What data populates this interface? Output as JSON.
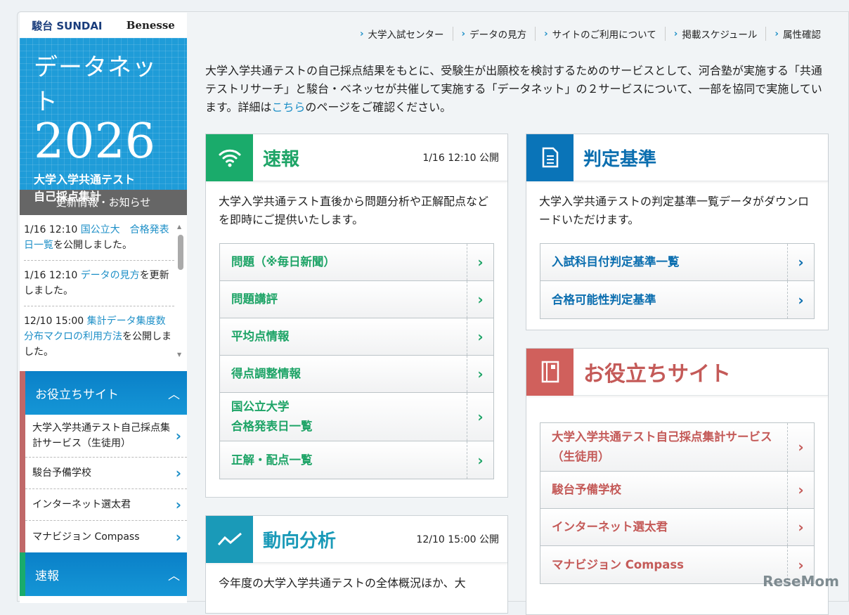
{
  "colors": {
    "green": "#1aab6b",
    "blue": "#0a74b8",
    "red": "#d0605c",
    "teal": "#1a9ab8"
  },
  "logos": {
    "sundai": "駿台 SUNDAI",
    "benesse": "Benesse"
  },
  "hero": {
    "line1": "データネット",
    "year": "2026",
    "line3": "大学入学共通テスト",
    "line4": "自己採点集計"
  },
  "news": {
    "header": "更新情報・お知らせ",
    "items": [
      {
        "date": "1/16 12:10 ",
        "link": "国公立大　合格発表日一覧",
        "rest": "を公開しました。"
      },
      {
        "date": "1/16 12:10 ",
        "link": "データの見方",
        "rest": "を更新しました。"
      },
      {
        "date": "12/10 15:00 ",
        "link": "集計データ集度数分布マクロの利用方法",
        "rest": "を公開しました。"
      }
    ]
  },
  "sidebar": {
    "useful": {
      "title": "お役立ちサイト",
      "items": [
        "大学入学共通テスト自己採点集計サービス（生徒用）",
        "駿台予備学校",
        "インターネット選太君",
        "マナビジョン Compass"
      ]
    },
    "sokuho": {
      "title": "速報"
    }
  },
  "topnav": [
    "大学入試センター",
    "データの見方",
    "サイトのご利用について",
    "掲載スケジュール",
    "属性確認"
  ],
  "intro": {
    "before": "大学入学共通テストの自己採点結果をもとに、受験生が出願校を検討するためのサービスとして、河合塾が実施する「共通テストリサーチ」と駿台・ベネッセが共催して実施する「データネット」の２サービスについて、一部を協同で実施しています。詳細は",
    "link": "こちら",
    "after": "のページをご確認ください。"
  },
  "cards": {
    "sokuho": {
      "title": "速報",
      "date": "1/16 12:10 公開",
      "desc": "大学入学共通テスト直後から問題分析や正解配点などを即時にご提供いたします。",
      "links": [
        "問題（※毎日新聞）",
        "問題講評",
        "平均点情報",
        "得点調整情報",
        "国公立大学\n合格発表日一覧",
        "正解・配点一覧"
      ]
    },
    "hantei": {
      "title": "判定基準",
      "desc": "大学入学共通テストの判定基準一覧データがダウンロードいただけます。",
      "links": [
        "入試科目付判定基準一覧",
        "合格可能性判定基準"
      ]
    },
    "oyaku": {
      "title": "お役立ちサイト",
      "links": [
        "大学入学共通テスト自己採点集計サービス（生徒用）",
        "駿台予備学校",
        "インターネット選太君",
        "マナビジョン Compass"
      ]
    },
    "doukou": {
      "title": "動向分析",
      "date": "12/10 15:00 公開",
      "desc": "今年度の大学入学共通テストの全体概況ほか、大"
    }
  },
  "watermark": "ReseMom"
}
